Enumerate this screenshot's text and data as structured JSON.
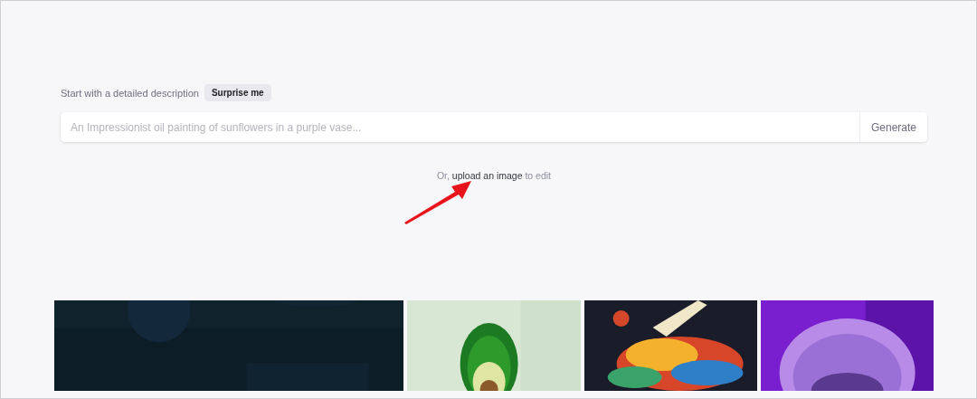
{
  "prompt": {
    "label": "Start with a detailed description",
    "surprise_button": "Surprise me",
    "placeholder": "An Impressionist oil painting of sunflowers in a purple vase...",
    "generate_button": "Generate"
  },
  "upload_line": {
    "prefix": "Or,",
    "link": "upload an image",
    "suffix": "to edit"
  }
}
